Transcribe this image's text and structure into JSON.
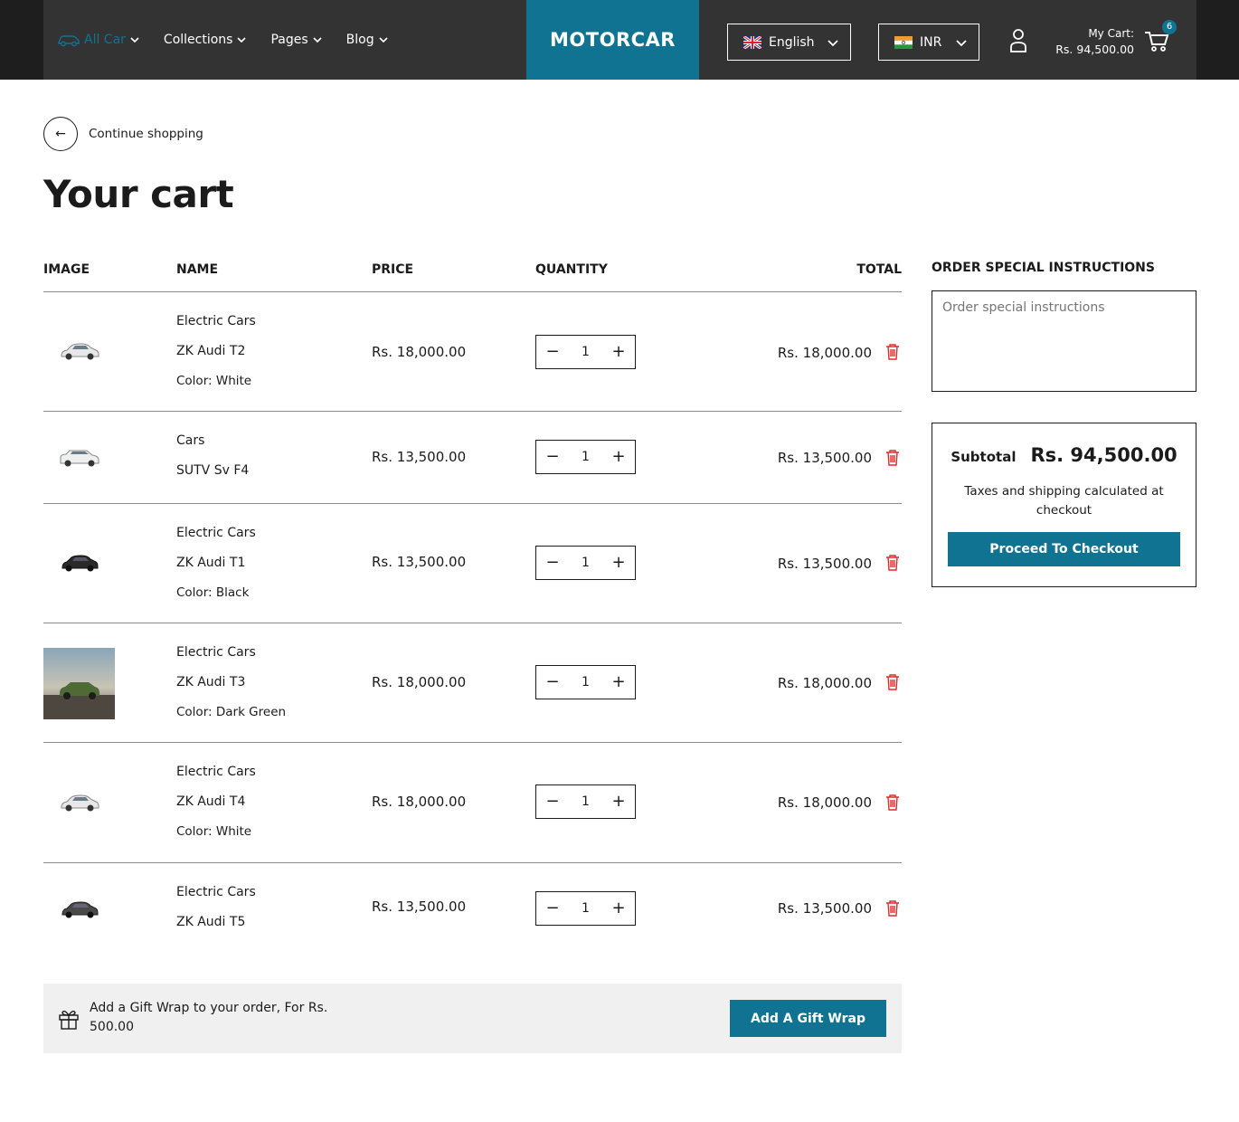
{
  "colors": {
    "accent": "#0f7391",
    "header_bg": "#333333",
    "danger": "#e02a2a"
  },
  "header": {
    "nav": [
      {
        "label": "All Car",
        "icon": "car-icon",
        "active": true
      },
      {
        "label": "Collections"
      },
      {
        "label": "Pages"
      },
      {
        "label": "Blog"
      }
    ],
    "logo": "MOTORCAR",
    "language": {
      "label": "English",
      "icon": "uk-flag-icon"
    },
    "currency": {
      "label": "INR",
      "icon": "india-flag-icon"
    },
    "cart": {
      "label": "My Cart:",
      "total": "Rs. 94,500.00",
      "count": "6"
    }
  },
  "continue_label": "Continue shopping",
  "title": "Your cart",
  "table": {
    "headers": {
      "image": "IMAGE",
      "name": "NAME",
      "price": "PRICE",
      "quantity": "QUANTITY",
      "total": "TOTAL"
    },
    "items": [
      {
        "category": "Electric Cars",
        "name": "ZK Audi T2",
        "option_label": "Color:",
        "option_value": "White",
        "price": "Rs. 18,000.00",
        "qty": "1",
        "total": "Rs. 18,000.00"
      },
      {
        "category": "Cars",
        "name": "SUTV Sv F4",
        "price": "Rs. 13,500.00",
        "qty": "1",
        "total": "Rs. 13,500.00"
      },
      {
        "category": "Electric Cars",
        "name": "ZK Audi T1",
        "option_label": "Color:",
        "option_value": "Black",
        "price": "Rs. 13,500.00",
        "qty": "1",
        "total": "Rs. 13,500.00"
      },
      {
        "category": "Electric Cars",
        "name": "ZK Audi T3",
        "option_label": "Color:",
        "option_value": "Dark Green",
        "price": "Rs. 18,000.00",
        "qty": "1",
        "total": "Rs. 18,000.00"
      },
      {
        "category": "Electric Cars",
        "name": "ZK Audi T4",
        "option_label": "Color:",
        "option_value": "White",
        "price": "Rs. 18,000.00",
        "qty": "1",
        "total": "Rs. 18,000.00"
      },
      {
        "category": "Electric Cars",
        "name": "ZK Audi T5",
        "price": "Rs. 13,500.00",
        "qty": "1",
        "total": "Rs. 13,500.00"
      }
    ]
  },
  "gift": {
    "text": "Add a Gift Wrap to your order, For Rs. 500.00",
    "button": "Add A Gift Wrap"
  },
  "instructions": {
    "title": "ORDER SPECIAL INSTRUCTIONS",
    "placeholder": "Order special instructions"
  },
  "summary": {
    "subtotal_label": "Subtotal",
    "subtotal_value": "Rs. 94,500.00",
    "tax_note": "Taxes and shipping calculated at checkout",
    "checkout": "Proceed To Checkout"
  }
}
